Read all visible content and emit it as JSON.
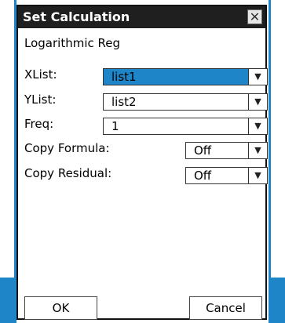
{
  "dialog": {
    "title": "Set Calculation",
    "close_glyph": "✕",
    "heading": "Logarithmic Reg",
    "xlist": {
      "label": "XList:",
      "value": "list1"
    },
    "ylist": {
      "label": "YList:",
      "value": "list2"
    },
    "freq": {
      "label": "Freq:",
      "value": "1"
    },
    "copy_formula": {
      "label": "Copy Formula:",
      "value": "Off"
    },
    "copy_residual": {
      "label": "Copy Residual:",
      "value": "Off"
    },
    "dropdown_glyph": "▼",
    "ok_label": "OK",
    "cancel_label": "Cancel"
  },
  "colors": {
    "accent": "#1e85c8",
    "titlebar": "#1f1f1f"
  }
}
